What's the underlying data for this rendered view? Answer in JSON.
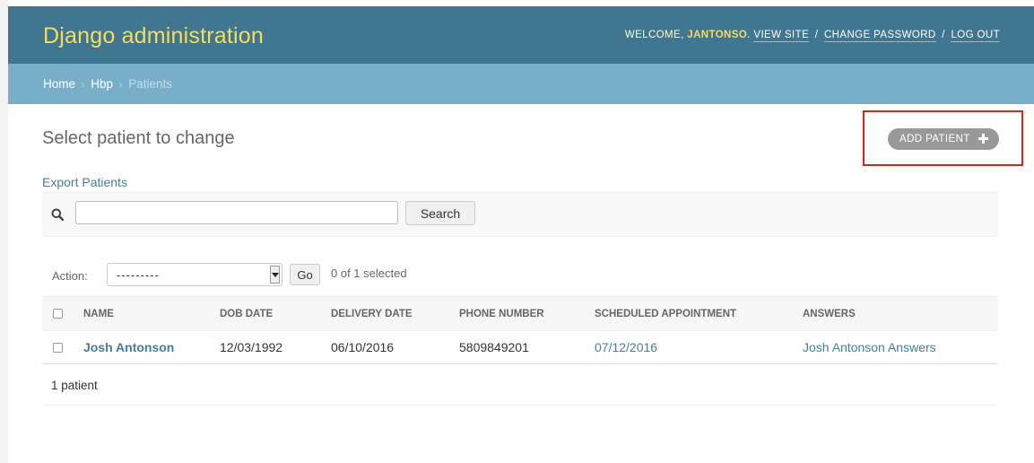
{
  "header": {
    "brand": "Django administration",
    "welcome_prefix": "Welcome,",
    "username": "jantonso",
    "welcome_suffix": ".",
    "view_site": "View site",
    "change_password": "Change password",
    "log_out": "Log out",
    "separator": "/"
  },
  "breadcrumbs": {
    "home": "Home",
    "app": "Hbp",
    "current": "Patients",
    "separator": "›"
  },
  "page": {
    "title": "Select patient to change",
    "add_button": "Add patient",
    "export_link": "Export Patients"
  },
  "search": {
    "value": "",
    "button": "Search",
    "icon": "search-icon"
  },
  "actions": {
    "label": "Action:",
    "selected_option": "---------",
    "go_button": "Go",
    "selected_count": "0 of 1 selected"
  },
  "table": {
    "columns": [
      "Name",
      "DOB date",
      "Delivery date",
      "Phone number",
      "Scheduled appointment",
      "Answers"
    ],
    "rows": [
      {
        "name": "Josh Antonson",
        "dob": "12/03/1992",
        "delivery": "06/10/2016",
        "phone": "5809849201",
        "appointment": "07/12/2016",
        "answers": "Josh Antonson Answers"
      }
    ]
  },
  "paginator": {
    "count_text": "1 patient"
  },
  "colors": {
    "header_bg": "#417690",
    "breadcrumb_bg": "#79aec8",
    "brand_yellow": "#f5dd5d",
    "link_blue": "#447e9b",
    "highlight_red": "#d9241b"
  }
}
